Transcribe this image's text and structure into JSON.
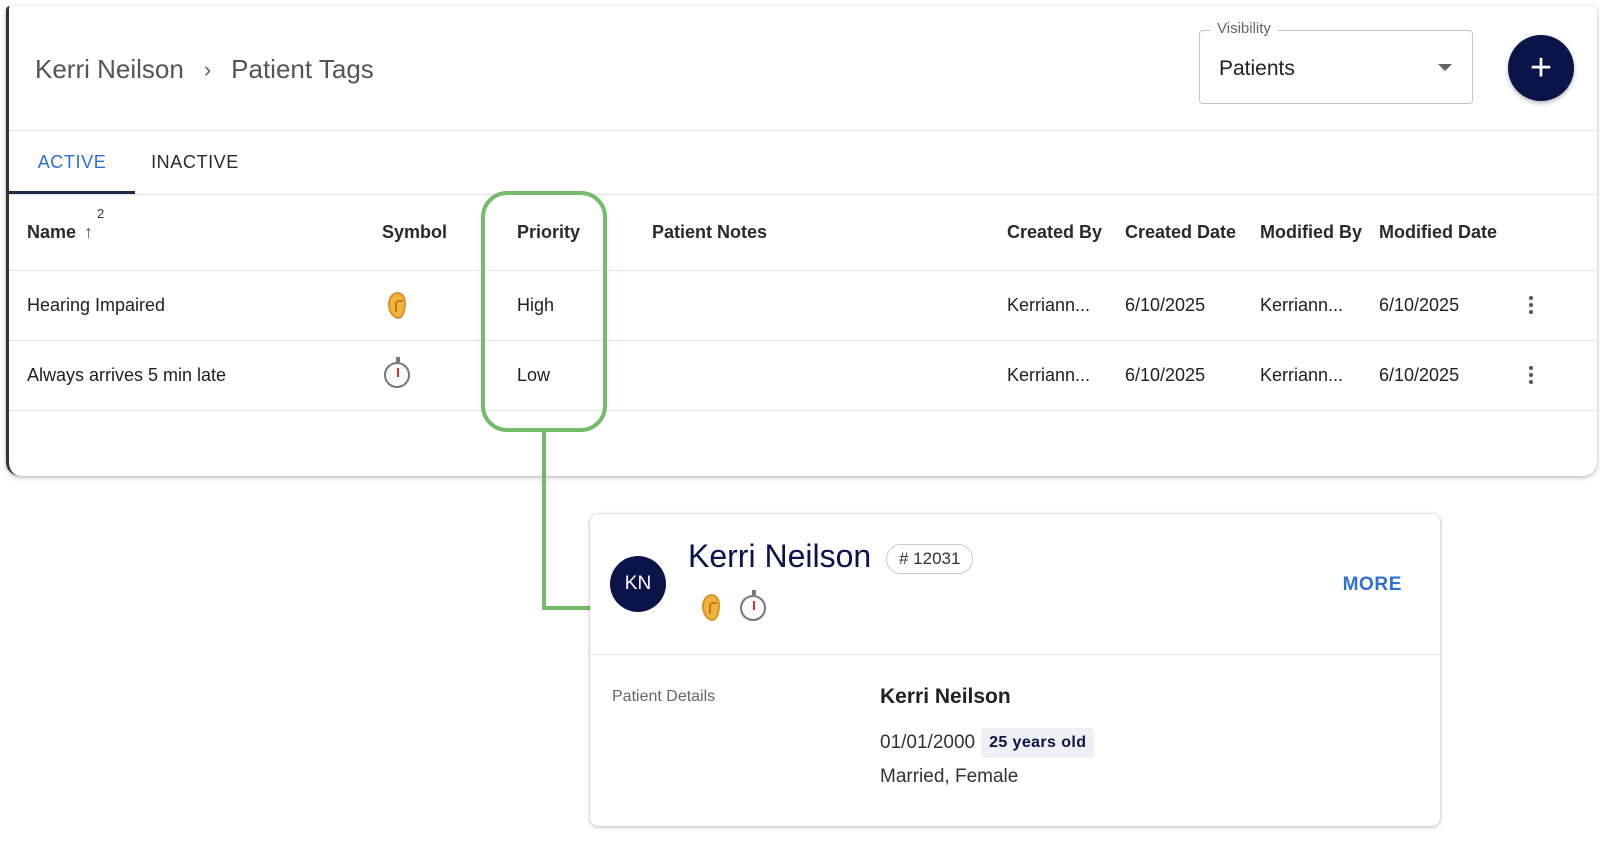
{
  "header": {
    "breadcrumb": [
      "Kerri Neilson",
      "Patient Tags"
    ],
    "breadcrumb_separator": "›",
    "visibility": {
      "label": "Visibility",
      "value": "Patients"
    },
    "add_button_label": "+"
  },
  "tabs": [
    {
      "label": "ACTIVE",
      "selected": true
    },
    {
      "label": "INACTIVE",
      "selected": false
    }
  ],
  "table": {
    "columns": [
      "Name",
      "Symbol",
      "Priority",
      "Patient Notes",
      "Created By",
      "Created Date",
      "Modified By",
      "Modified Date"
    ],
    "sort": {
      "column": "Name",
      "direction": "ascending",
      "priority": "2"
    },
    "rows": [
      {
        "name": "Hearing Impaired",
        "symbol": "ear-icon",
        "priority": "High",
        "notes": "",
        "created_by": "Kerriann...",
        "created_date": "6/10/2025",
        "modified_by": "Kerriann...",
        "modified_date": "6/10/2025"
      },
      {
        "name": "Always arrives 5 min late",
        "symbol": "stopwatch-icon",
        "priority": "Low",
        "notes": "",
        "created_by": "Kerriann...",
        "created_date": "6/10/2025",
        "modified_by": "Kerriann...",
        "modified_date": "6/10/2025"
      }
    ]
  },
  "patient_card": {
    "initials": "KN",
    "name": "Kerri Neilson",
    "id_badge": "# 12031",
    "symbols": [
      "ear-icon",
      "stopwatch-icon"
    ],
    "more_label": "MORE",
    "details_label": "Patient Details",
    "details_name": "Kerri Neilson",
    "dob": "01/01/2000",
    "age": "25 years old",
    "status": "Married, Female"
  },
  "colors": {
    "accent_blue": "#2f6fd6",
    "navy": "#0b1449",
    "highlight_green": "#74bb6a"
  }
}
